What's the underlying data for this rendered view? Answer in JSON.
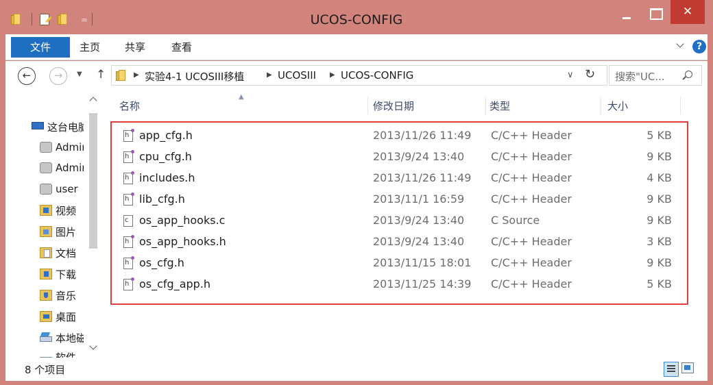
{
  "window": {
    "title": "UCOS-CONFIG",
    "qat_dropdown": "=",
    "close_glyph": "✕"
  },
  "ribbon": {
    "tabs": [
      {
        "label": "文件",
        "active": true
      },
      {
        "label": "主页"
      },
      {
        "label": "共享"
      },
      {
        "label": "查看"
      }
    ],
    "help_glyph": "?"
  },
  "navigation": {
    "back_glyph": "←",
    "forward_glyph": "→",
    "recent_glyph": "▼",
    "up_glyph": "↑",
    "breadcrumb": [
      "实验4-1 UCOSIII移植",
      "UCOSIII",
      "UCOS-CONFIG"
    ],
    "crumb_separator": "▶",
    "dropdown_glyph": "∨",
    "refresh_glyph": "↻",
    "search_placeholder": "搜索\"UC..."
  },
  "nav_pane": {
    "items": [
      {
        "label": "这台电脑",
        "icon": "computer-icon"
      },
      {
        "label": "Administrator",
        "icon": "user-folder-icon"
      },
      {
        "label": "Administrator",
        "icon": "user-folder-icon"
      },
      {
        "label": "user",
        "icon": "user-folder-icon"
      },
      {
        "label": "视频",
        "icon": "videos-folder-icon"
      },
      {
        "label": "图片",
        "icon": "pictures-folder-icon"
      },
      {
        "label": "文档",
        "icon": "documents-folder-icon"
      },
      {
        "label": "下载",
        "icon": "downloads-folder-icon"
      },
      {
        "label": "音乐",
        "icon": "music-folder-icon"
      },
      {
        "label": "桌面",
        "icon": "desktop-folder-icon"
      },
      {
        "label": "本地磁盘",
        "icon": "local-disk-icon"
      },
      {
        "label": "软件",
        "icon": "drive-icon"
      }
    ]
  },
  "file_list": {
    "columns": {
      "name": "名称",
      "date": "修改日期",
      "type": "类型",
      "size": "大小"
    },
    "sort_glyph": "▲",
    "rows": [
      {
        "name": "app_cfg.h",
        "date": "2013/11/26 11:49",
        "type": "C/C++ Header",
        "size": "5 KB",
        "icon": "h-file-icon"
      },
      {
        "name": "cpu_cfg.h",
        "date": "2013/9/24 13:40",
        "type": "C/C++ Header",
        "size": "9 KB",
        "icon": "h-file-icon"
      },
      {
        "name": "includes.h",
        "date": "2013/11/26 11:49",
        "type": "C/C++ Header",
        "size": "4 KB",
        "icon": "h-file-icon"
      },
      {
        "name": "lib_cfg.h",
        "date": "2013/11/1 16:59",
        "type": "C/C++ Header",
        "size": "9 KB",
        "icon": "h-file-icon"
      },
      {
        "name": "os_app_hooks.c",
        "date": "2013/9/24 13:40",
        "type": "C Source",
        "size": "9 KB",
        "icon": "c-file-icon"
      },
      {
        "name": "os_app_hooks.h",
        "date": "2013/9/24 13:40",
        "type": "C/C++ Header",
        "size": "3 KB",
        "icon": "h-file-icon"
      },
      {
        "name": "os_cfg.h",
        "date": "2013/11/15 18:01",
        "type": "C/C++ Header",
        "size": "9 KB",
        "icon": "h-file-icon"
      },
      {
        "name": "os_cfg_app.h",
        "date": "2013/11/25 14:39",
        "type": "C/C++ Header",
        "size": "5 KB",
        "icon": "h-file-icon"
      }
    ]
  },
  "status": {
    "item_count": "8 个项目"
  },
  "colors": {
    "title_bar": "#d2847c",
    "close_button": "#c23b33",
    "file_tab": "#1e6fc1",
    "highlight_box": "#e23b3b"
  }
}
